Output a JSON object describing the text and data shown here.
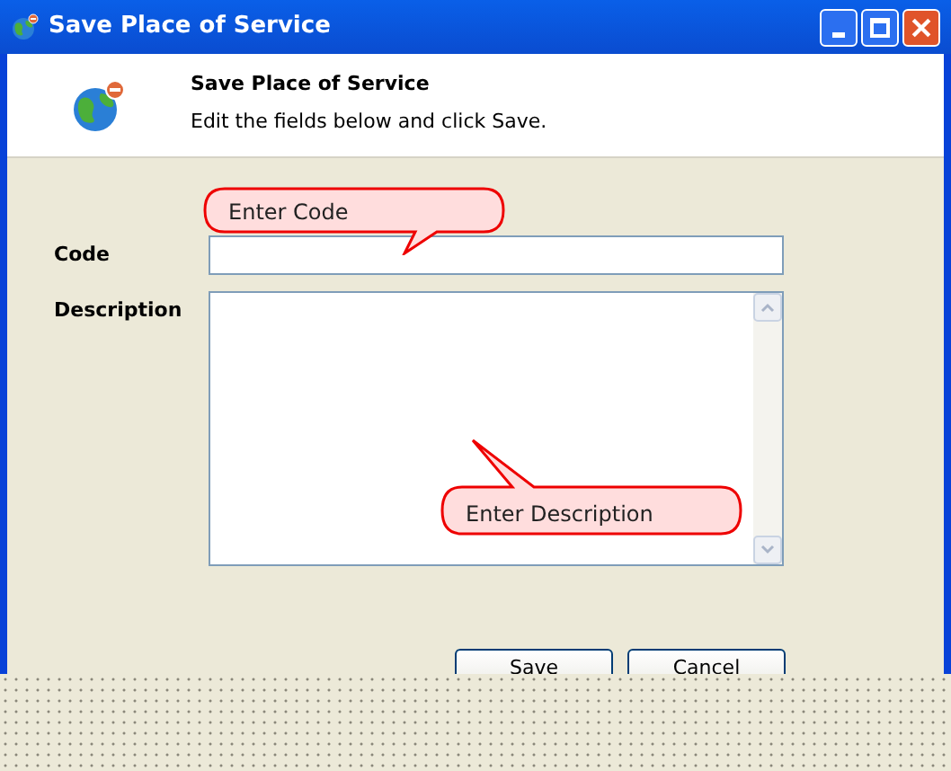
{
  "window": {
    "title": "Save Place of Service"
  },
  "header": {
    "title": "Save Place of Service",
    "subtitle": "Edit the fields below and click Save."
  },
  "fields": [
    {
      "kind": "line",
      "label": "Code"
    },
    {
      "kind": "multiline",
      "label": "Description"
    }
  ],
  "callouts": [
    {
      "text": "Enter Code",
      "kind": "down"
    },
    {
      "text": "Enter Description",
      "kind": "up"
    }
  ],
  "buttons": [
    "Save",
    "Cancel"
  ]
}
